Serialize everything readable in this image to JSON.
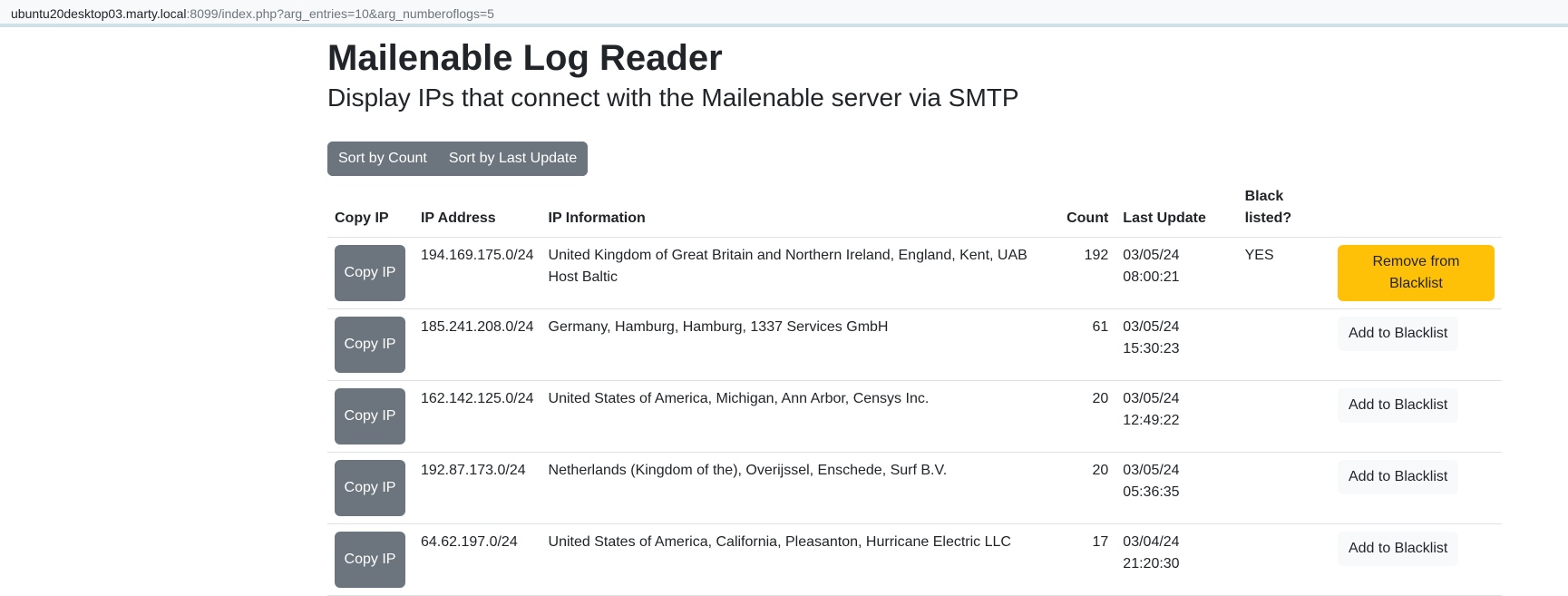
{
  "browser": {
    "url_host": "ubuntu20desktop03.marty.local",
    "url_rest": ":8099/index.php?arg_entries=10&arg_numberoflogs=5"
  },
  "page": {
    "title": "Mailenable Log Reader",
    "subtitle": "Display IPs that connect with the Mailenable server via SMTP"
  },
  "sort": {
    "by_count": "Sort by Count",
    "by_last_update": "Sort by Last Update"
  },
  "table": {
    "headers": {
      "copy_ip": "Copy IP",
      "ip_address": "IP Address",
      "ip_information": "IP Information",
      "count": "Count",
      "last_update": "Last Update",
      "blacklisted": "Black listed?"
    },
    "rows": [
      {
        "copy_label": "Copy IP",
        "ip": "194.169.175.0/24",
        "info": "United Kingdom of Great Britain and Northern Ireland, England, Kent, UAB Host Baltic",
        "count": "192",
        "date": "03/05/24",
        "time": "08:00:21",
        "blacklisted": "YES",
        "action": "Remove from Blacklist"
      },
      {
        "copy_label": "Copy IP",
        "ip": "185.241.208.0/24",
        "info": "Germany, Hamburg, Hamburg, 1337 Services GmbH",
        "count": "61",
        "date": "03/05/24",
        "time": "15:30:23",
        "blacklisted": "",
        "action": "Add to Blacklist"
      },
      {
        "copy_label": "Copy IP",
        "ip": "162.142.125.0/24",
        "info": "United States of America, Michigan, Ann Arbor, Censys Inc.",
        "count": "20",
        "date": "03/05/24",
        "time": "12:49:22",
        "blacklisted": "",
        "action": "Add to Blacklist"
      },
      {
        "copy_label": "Copy IP",
        "ip": "192.87.173.0/24",
        "info": "Netherlands (Kingdom of the), Overijssel, Enschede, Surf B.V.",
        "count": "20",
        "date": "03/05/24",
        "time": "05:36:35",
        "blacklisted": "",
        "action": "Add to Blacklist"
      },
      {
        "copy_label": "Copy IP",
        "ip": "64.62.197.0/24",
        "info": "United States of America, California, Pleasanton, Hurricane Electric LLC",
        "count": "17",
        "date": "03/04/24",
        "time": "21:20:30",
        "blacklisted": "",
        "action": "Add to Blacklist"
      }
    ]
  },
  "colors": {
    "secondary": "#6c757d",
    "warning": "#ffc107",
    "light": "#f8f9fa"
  }
}
